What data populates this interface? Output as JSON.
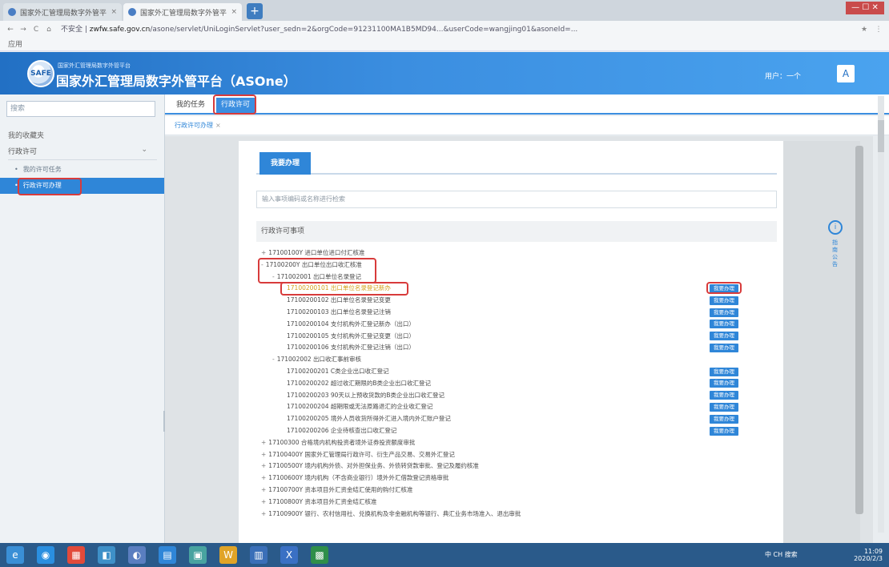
{
  "browser": {
    "tabs": [
      {
        "title": "国家外汇管理局数字外管平台",
        "close": "×"
      },
      {
        "title": "国家外汇管理局数字外管平台",
        "close": "×"
      }
    ],
    "newtab": "+",
    "window_controls": "— ☐ ✕",
    "nav": [
      "←",
      "→",
      "C",
      "⌂"
    ],
    "url_prefix": "不安全 | ",
    "url_host": "zwfw.safe.gov.cn",
    "url_path": "/asone/servlet/UniLoginServlet?user_sedn=2&orgCode=91231100MA1B5MD94...&userCode=wangjing01&asoneId=...",
    "extensions": [
      "★",
      "⋮"
    ],
    "bookmarks": "应用"
  },
  "header": {
    "logo_text": "SAFE",
    "subtitle": "国家外汇管理局数字外管平台",
    "title": "国家外汇管理局数字外管平台（ASOne）",
    "user": "用户：一个",
    "avatar_glyph": "A"
  },
  "sidebar": {
    "search_placeholder": "搜索",
    "favorites": "我的收藏夹",
    "section": "行政许可",
    "chevron": "⌄",
    "items": [
      {
        "label": "我的许可任务"
      },
      {
        "label": "行政许可办理"
      }
    ]
  },
  "tabs": {
    "my_tasks": "我的任务",
    "admin_license": "行政许可"
  },
  "breadcrumb": {
    "label": "行政许可办理",
    "close": "×"
  },
  "panel": {
    "tab": "我要办理",
    "search_placeholder": "输入事项编码或名称进行检索",
    "section_title": "行政许可事项",
    "guide_label": "指南公告",
    "guide_glyph": "i",
    "action_label": "我要办理",
    "tree": [
      {
        "indent": 0,
        "lead": "+",
        "text": "17100100Y 进口单位进口付汇核准"
      },
      {
        "indent": 0,
        "lead": "-",
        "text": "17100200Y 出口单位出口收汇核准"
      },
      {
        "indent": 1,
        "lead": "-",
        "text": "171002001 出口单位名录登记"
      },
      {
        "indent": 2,
        "lead": "",
        "text": "17100200101 出口单位名录登记新办",
        "action": true,
        "highlight": true
      },
      {
        "indent": 2,
        "lead": "",
        "text": "17100200102 出口单位名录登记变更",
        "action": true
      },
      {
        "indent": 2,
        "lead": "",
        "text": "17100200103 出口单位名录登记注销",
        "action": true
      },
      {
        "indent": 2,
        "lead": "",
        "text": "17100200104 支付机构外汇登记新办（出口）",
        "action": true
      },
      {
        "indent": 2,
        "lead": "",
        "text": "17100200105 支付机构外汇登记变更（出口）",
        "action": true
      },
      {
        "indent": 2,
        "lead": "",
        "text": "17100200106 支付机构外汇登记注销（出口）",
        "action": true
      },
      {
        "indent": 1,
        "lead": "-",
        "text": "171002002 出口收汇事前审核"
      },
      {
        "indent": 2,
        "lead": "",
        "text": "17100200201 C类企业出口收汇登记",
        "action": true
      },
      {
        "indent": 2,
        "lead": "",
        "text": "17100200202 超过收汇期限的B类企业出口收汇登记",
        "action": true
      },
      {
        "indent": 2,
        "lead": "",
        "text": "17100200203 90天以上预收货款的B类企业出口收汇登记",
        "action": true
      },
      {
        "indent": 2,
        "lead": "",
        "text": "17100200204 超期限或无法原路退汇的企业收汇登记",
        "action": true
      },
      {
        "indent": 2,
        "lead": "",
        "text": "17100200205 境外人员收货所得外汇进入境内外汇账户登记",
        "action": true
      },
      {
        "indent": 2,
        "lead": "",
        "text": "17100200206 企业待核查出口收汇登记",
        "action": true
      },
      {
        "indent": 0,
        "lead": "+",
        "text": "17100300 合格境内机构投资者境外证券投资额度审批"
      },
      {
        "indent": 0,
        "lead": "+",
        "text": "17100400Y 国家外汇管理局行政许可、衍生产品交易、交易外汇登记"
      },
      {
        "indent": 0,
        "lead": "+",
        "text": "17100500Y 境内机构外债、对外担保业务、外债转贷款审批、登记及履约核准"
      },
      {
        "indent": 0,
        "lead": "+",
        "text": "17100600Y 境内机构（不含商业银行）境外外汇借款登记资格审批"
      },
      {
        "indent": 0,
        "lead": "+",
        "text": "17100700Y 资本项目外汇资金结汇使用的购付汇核准"
      },
      {
        "indent": 0,
        "lead": "+",
        "text": "17100800Y 资本项目外汇资金结汇核准"
      },
      {
        "indent": 0,
        "lead": "+",
        "text": "17100900Y 银行、农村信用社、兑换机构及非金融机构等银行、典汇业务市场准入、退出审批"
      }
    ]
  },
  "taskbar": {
    "icons": [
      "e",
      "◉",
      "▦",
      "◧",
      "◐",
      "▤",
      "▣",
      "W",
      "▥",
      "X",
      "▩"
    ],
    "lang": "中 CH 搜索",
    "time": "11:09",
    "date": "2020/2/3"
  },
  "colors": {
    "accent": "#2f86d8",
    "header_start": "#2270c4",
    "highlight_text": "#d4a01b",
    "annotation": "#d83b3b"
  }
}
